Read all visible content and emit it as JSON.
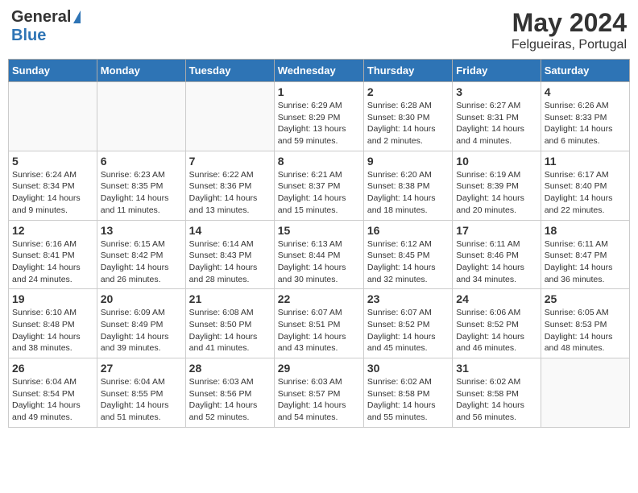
{
  "header": {
    "logo_general": "General",
    "logo_blue": "Blue",
    "title": "May 2024",
    "subtitle": "Felgueiras, Portugal"
  },
  "days_of_week": [
    "Sunday",
    "Monday",
    "Tuesday",
    "Wednesday",
    "Thursday",
    "Friday",
    "Saturday"
  ],
  "weeks": [
    [
      {
        "day": "",
        "info": ""
      },
      {
        "day": "",
        "info": ""
      },
      {
        "day": "",
        "info": ""
      },
      {
        "day": "1",
        "info": "Sunrise: 6:29 AM\nSunset: 8:29 PM\nDaylight: 13 hours\nand 59 minutes."
      },
      {
        "day": "2",
        "info": "Sunrise: 6:28 AM\nSunset: 8:30 PM\nDaylight: 14 hours\nand 2 minutes."
      },
      {
        "day": "3",
        "info": "Sunrise: 6:27 AM\nSunset: 8:31 PM\nDaylight: 14 hours\nand 4 minutes."
      },
      {
        "day": "4",
        "info": "Sunrise: 6:26 AM\nSunset: 8:33 PM\nDaylight: 14 hours\nand 6 minutes."
      }
    ],
    [
      {
        "day": "5",
        "info": "Sunrise: 6:24 AM\nSunset: 8:34 PM\nDaylight: 14 hours\nand 9 minutes."
      },
      {
        "day": "6",
        "info": "Sunrise: 6:23 AM\nSunset: 8:35 PM\nDaylight: 14 hours\nand 11 minutes."
      },
      {
        "day": "7",
        "info": "Sunrise: 6:22 AM\nSunset: 8:36 PM\nDaylight: 14 hours\nand 13 minutes."
      },
      {
        "day": "8",
        "info": "Sunrise: 6:21 AM\nSunset: 8:37 PM\nDaylight: 14 hours\nand 15 minutes."
      },
      {
        "day": "9",
        "info": "Sunrise: 6:20 AM\nSunset: 8:38 PM\nDaylight: 14 hours\nand 18 minutes."
      },
      {
        "day": "10",
        "info": "Sunrise: 6:19 AM\nSunset: 8:39 PM\nDaylight: 14 hours\nand 20 minutes."
      },
      {
        "day": "11",
        "info": "Sunrise: 6:17 AM\nSunset: 8:40 PM\nDaylight: 14 hours\nand 22 minutes."
      }
    ],
    [
      {
        "day": "12",
        "info": "Sunrise: 6:16 AM\nSunset: 8:41 PM\nDaylight: 14 hours\nand 24 minutes."
      },
      {
        "day": "13",
        "info": "Sunrise: 6:15 AM\nSunset: 8:42 PM\nDaylight: 14 hours\nand 26 minutes."
      },
      {
        "day": "14",
        "info": "Sunrise: 6:14 AM\nSunset: 8:43 PM\nDaylight: 14 hours\nand 28 minutes."
      },
      {
        "day": "15",
        "info": "Sunrise: 6:13 AM\nSunset: 8:44 PM\nDaylight: 14 hours\nand 30 minutes."
      },
      {
        "day": "16",
        "info": "Sunrise: 6:12 AM\nSunset: 8:45 PM\nDaylight: 14 hours\nand 32 minutes."
      },
      {
        "day": "17",
        "info": "Sunrise: 6:11 AM\nSunset: 8:46 PM\nDaylight: 14 hours\nand 34 minutes."
      },
      {
        "day": "18",
        "info": "Sunrise: 6:11 AM\nSunset: 8:47 PM\nDaylight: 14 hours\nand 36 minutes."
      }
    ],
    [
      {
        "day": "19",
        "info": "Sunrise: 6:10 AM\nSunset: 8:48 PM\nDaylight: 14 hours\nand 38 minutes."
      },
      {
        "day": "20",
        "info": "Sunrise: 6:09 AM\nSunset: 8:49 PM\nDaylight: 14 hours\nand 39 minutes."
      },
      {
        "day": "21",
        "info": "Sunrise: 6:08 AM\nSunset: 8:50 PM\nDaylight: 14 hours\nand 41 minutes."
      },
      {
        "day": "22",
        "info": "Sunrise: 6:07 AM\nSunset: 8:51 PM\nDaylight: 14 hours\nand 43 minutes."
      },
      {
        "day": "23",
        "info": "Sunrise: 6:07 AM\nSunset: 8:52 PM\nDaylight: 14 hours\nand 45 minutes."
      },
      {
        "day": "24",
        "info": "Sunrise: 6:06 AM\nSunset: 8:52 PM\nDaylight: 14 hours\nand 46 minutes."
      },
      {
        "day": "25",
        "info": "Sunrise: 6:05 AM\nSunset: 8:53 PM\nDaylight: 14 hours\nand 48 minutes."
      }
    ],
    [
      {
        "day": "26",
        "info": "Sunrise: 6:04 AM\nSunset: 8:54 PM\nDaylight: 14 hours\nand 49 minutes."
      },
      {
        "day": "27",
        "info": "Sunrise: 6:04 AM\nSunset: 8:55 PM\nDaylight: 14 hours\nand 51 minutes."
      },
      {
        "day": "28",
        "info": "Sunrise: 6:03 AM\nSunset: 8:56 PM\nDaylight: 14 hours\nand 52 minutes."
      },
      {
        "day": "29",
        "info": "Sunrise: 6:03 AM\nSunset: 8:57 PM\nDaylight: 14 hours\nand 54 minutes."
      },
      {
        "day": "30",
        "info": "Sunrise: 6:02 AM\nSunset: 8:58 PM\nDaylight: 14 hours\nand 55 minutes."
      },
      {
        "day": "31",
        "info": "Sunrise: 6:02 AM\nSunset: 8:58 PM\nDaylight: 14 hours\nand 56 minutes."
      },
      {
        "day": "",
        "info": ""
      }
    ]
  ]
}
